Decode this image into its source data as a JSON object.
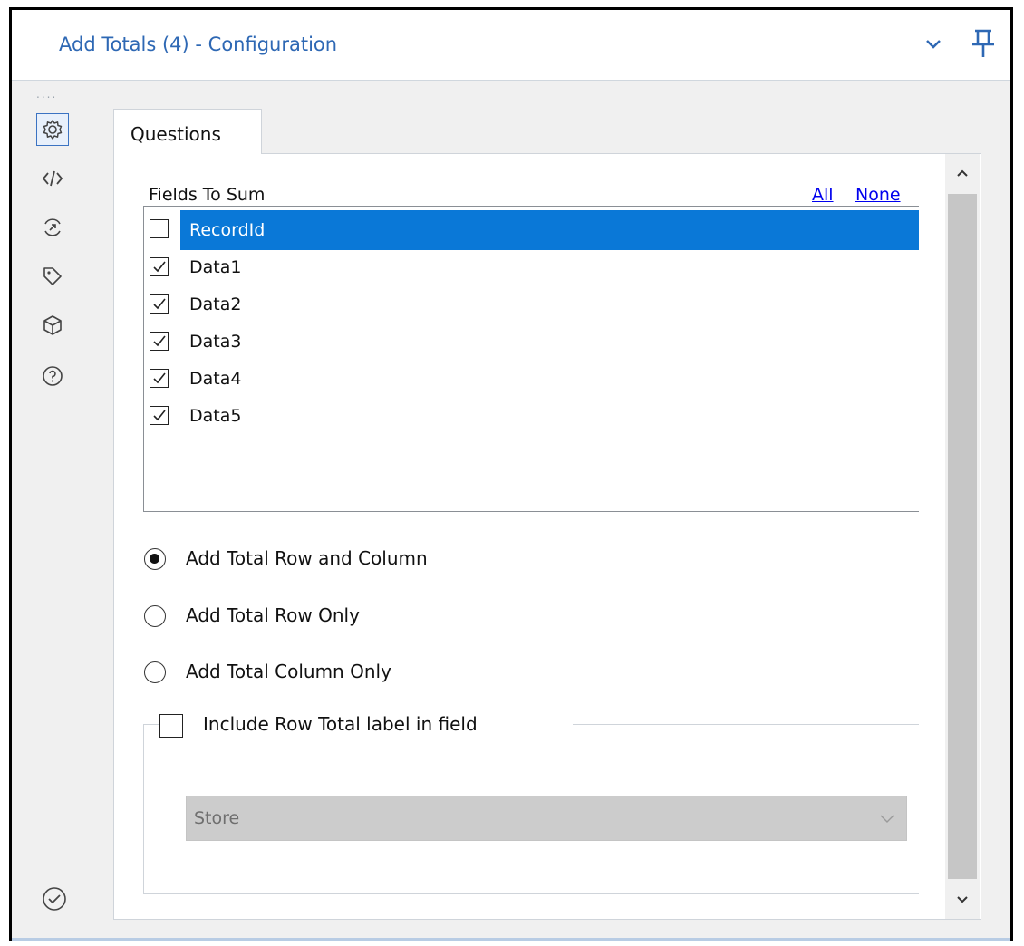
{
  "header": {
    "title": "Add Totals (4) - Configuration",
    "collapse_icon": "chevron-down-icon",
    "pin_icon": "pin-icon"
  },
  "sidebar": {
    "grip": "....",
    "items": [
      {
        "icon": "gear-icon",
        "active": true
      },
      {
        "icon": "code-icon",
        "active": false
      },
      {
        "icon": "convert-icon",
        "active": false
      },
      {
        "icon": "tag-icon",
        "active": false
      },
      {
        "icon": "cube-icon",
        "active": false
      },
      {
        "icon": "help-icon",
        "active": false
      }
    ],
    "bottom_icon": "check-circle-icon"
  },
  "tabs": [
    {
      "label": "Questions",
      "active": true
    }
  ],
  "fields": {
    "label": "Fields To Sum",
    "all_link": "All",
    "none_link": "None",
    "items": [
      {
        "name": "RecordId",
        "checked": false,
        "selected": true
      },
      {
        "name": "Data1",
        "checked": true,
        "selected": false
      },
      {
        "name": "Data2",
        "checked": true,
        "selected": false
      },
      {
        "name": "Data3",
        "checked": true,
        "selected": false
      },
      {
        "name": "Data4",
        "checked": true,
        "selected": false
      },
      {
        "name": "Data5",
        "checked": true,
        "selected": false
      }
    ]
  },
  "options": [
    {
      "label": "Add Total Row and Column",
      "selected": true
    },
    {
      "label": "Add Total Row Only",
      "selected": false
    },
    {
      "label": "Add Total Column Only",
      "selected": false
    }
  ],
  "row_total": {
    "label": "Include Row Total label in field",
    "checked": false,
    "select_value": "Store",
    "select_disabled": true
  },
  "colors": {
    "accent": "#2e68b4",
    "selection": "#0a78d7",
    "link": "#0000ee"
  }
}
